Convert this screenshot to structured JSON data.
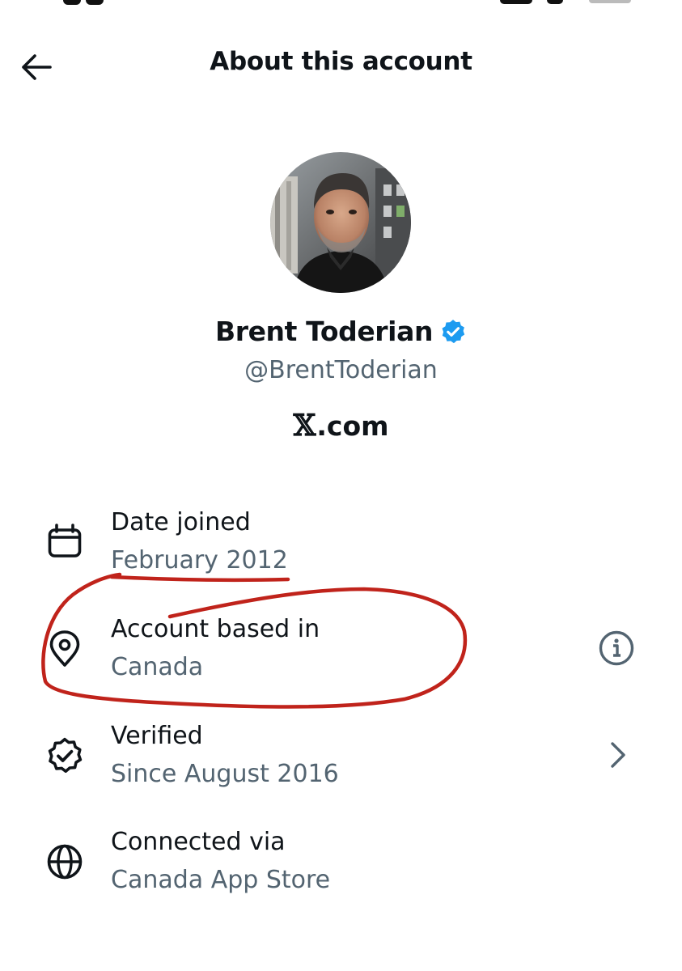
{
  "header": {
    "title": "About this account",
    "back_icon": "arrow-left-icon"
  },
  "profile": {
    "name": "Brent Toderian",
    "handle": "@BrentToderian",
    "verified_icon": "verified-badge-icon",
    "verified_color": "#1d9bf0",
    "platform_logo": "𝕏",
    "platform_suffix": ".com"
  },
  "details": [
    {
      "icon": "calendar-icon",
      "label": "Date joined",
      "value": "February 2012"
    },
    {
      "icon": "location-pin-icon",
      "label": "Account based in",
      "value": "Canada",
      "trailing_icon": "info-icon"
    },
    {
      "icon": "verified-check-icon",
      "label": "Verified",
      "value": "Since August 2016",
      "trailing_icon": "chevron-right-icon"
    },
    {
      "icon": "globe-icon",
      "label": "Connected via",
      "value": "Canada App Store"
    }
  ],
  "colors": {
    "text_primary": "#0f1419",
    "text_secondary": "#536471",
    "annotation_red": "#c0231b"
  }
}
